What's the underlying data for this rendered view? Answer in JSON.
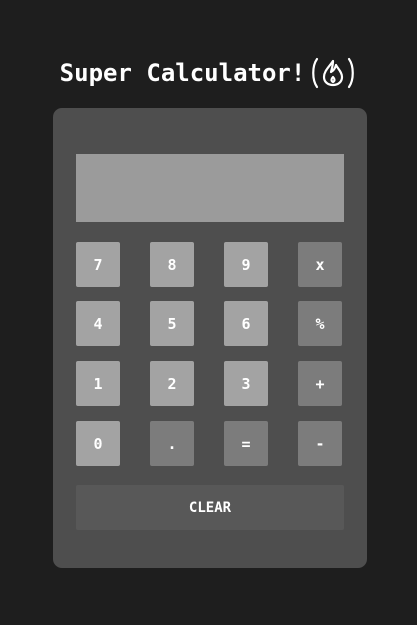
{
  "title": {
    "text": "Super Calculator!",
    "icon": "flame-icon"
  },
  "display": {
    "value": ""
  },
  "keys": {
    "k7": "7",
    "k8": "8",
    "k9": "9",
    "multiply": "x",
    "k4": "4",
    "k5": "5",
    "k6": "6",
    "percent": "%",
    "k1": "1",
    "k2": "2",
    "k3": "3",
    "plus": "+",
    "k0": "0",
    "dot": ".",
    "equals": "=",
    "minus": "-"
  },
  "clear_label": "CLEAR",
  "colors": {
    "background": "#1e1e1e",
    "calculator_body": "#4e4e4e",
    "display": "#9b9b9b",
    "number_key": "#a3a3a3",
    "operator_key": "#7c7c7c",
    "clear_key": "#585858",
    "text": "#ffffff"
  }
}
